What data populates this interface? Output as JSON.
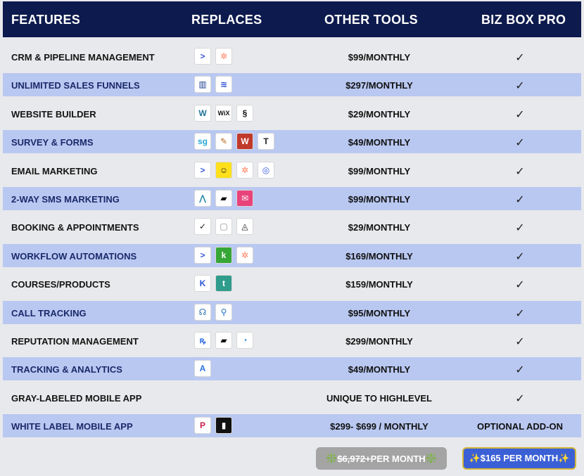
{
  "header": {
    "features": "FEATURES",
    "replaces": "REPLACES",
    "other_tools": "OTHER TOOLS",
    "biz_box_pro": "BIZ BOX PRO"
  },
  "rows": [
    {
      "feature": "CRM & PIPELINE MANAGEMENT",
      "icons": [
        "activecampaign-icon",
        "hubspot-icon"
      ],
      "other": "$99/MONTHLY",
      "biz": "✓"
    },
    {
      "feature": "UNLIMITED SALES FUNNELS",
      "icons": [
        "clickfunnels-icon",
        "stack-layers-icon"
      ],
      "other": "$297/MONTHLY",
      "biz": "✓"
    },
    {
      "feature": "WEBSITE BUILDER",
      "icons": [
        "wordpress-icon",
        "wix-icon",
        "squarespace-icon"
      ],
      "other": "$29/MONTHLY",
      "biz": "✓"
    },
    {
      "feature": "SURVEY & FORMS",
      "icons": [
        "surveygizmo-icon",
        "quill-icon",
        "wufoo-icon",
        "typeform-icon"
      ],
      "other": "$49/MONTHLY",
      "biz": "✓"
    },
    {
      "feature": "EMAIL MARKETING",
      "icons": [
        "activecampaign-icon",
        "mailchimp-icon",
        "hubspot-icon",
        "constantcontact-icon"
      ],
      "other": "$99/MONTHLY",
      "biz": "✓"
    },
    {
      "feature": "2-WAY SMS MARKETING",
      "icons": [
        "chevrons-icon",
        "flag-icon",
        "envelope-icon"
      ],
      "other": "$99/MONTHLY",
      "biz": "✓"
    },
    {
      "feature": "BOOKING & APPOINTMENTS",
      "icons": [
        "calendly-icon",
        "calendar-icon",
        "acuity-icon"
      ],
      "other": "$29/MONTHLY",
      "biz": "✓"
    },
    {
      "feature": "WORKFLOW AUTOMATIONS",
      "icons": [
        "activecampaign-icon",
        "keap-icon",
        "hubspot-icon"
      ],
      "other": "$169/MONTHLY",
      "biz": "✓"
    },
    {
      "feature": "COURSES/PRODUCTS",
      "icons": [
        "kajabi-icon",
        "teachable-icon"
      ],
      "other": "$159/MONTHLY",
      "biz": "✓"
    },
    {
      "feature": "CALL TRACKING",
      "icons": [
        "callrail-icon",
        "location-pin-icon"
      ],
      "other": "$95/MONTHLY",
      "biz": "✓"
    },
    {
      "feature": "REPUTATION MANAGEMENT",
      "icons": [
        "birdeye-icon",
        "flag-icon",
        "pie-icon"
      ],
      "other": "$299/MONTHLY",
      "biz": "✓"
    },
    {
      "feature": "TRACKING & ANALYTICS",
      "icons": [
        "analytics-icon"
      ],
      "other": "$49/MONTHLY",
      "biz": "✓"
    },
    {
      "feature": "GRAY-LABELED MOBILE APP",
      "icons": [],
      "other": "UNIQUE TO HIGHLEVEL",
      "biz": "✓"
    },
    {
      "feature": "WHITE LABEL MOBILE APP",
      "icons": [
        "app-p-icon",
        "builder-icon"
      ],
      "other": "$299- $699 / MONTHLY",
      "biz": "OPTIONAL ADD-ON"
    }
  ],
  "pricing": {
    "old_sparkle_left": "❇️",
    "old_amount": "$6,972+",
    "old_suffix": " PER MONTH",
    "old_sparkle_right": "❇️",
    "new_label": "✨$165 PER MONTH✨"
  },
  "colors": {
    "header_bg": "#0d1a4d",
    "alt_row_bg": "#b9c8f1",
    "new_price_bg": "#3b60d6",
    "old_price_bg": "#a4a4a4"
  }
}
